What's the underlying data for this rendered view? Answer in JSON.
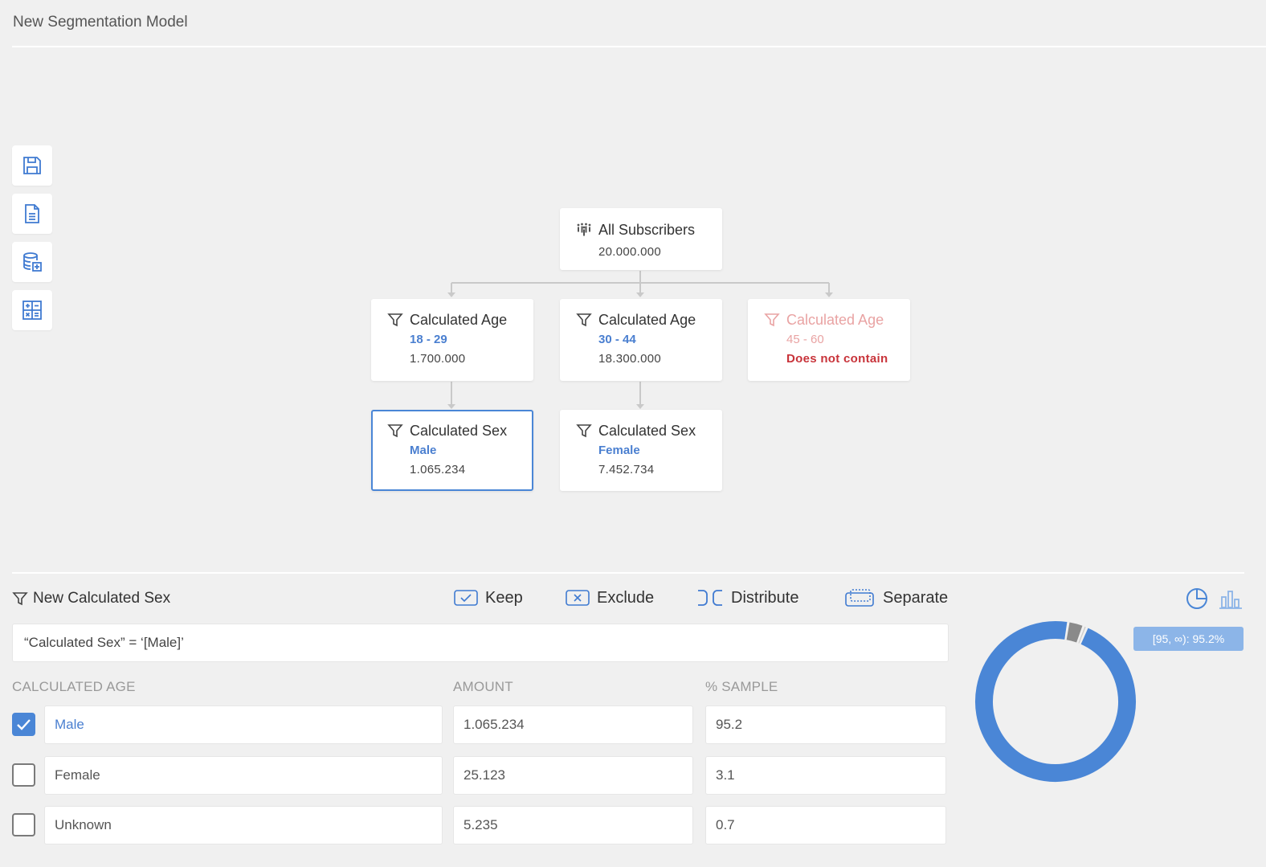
{
  "app": {
    "title": "New Segmentation Model"
  },
  "toolbar": {
    "icons": [
      "save-icon",
      "document-icon",
      "add-database-icon",
      "calculator-icon"
    ]
  },
  "tree": {
    "root": {
      "label": "All Subscribers",
      "count": "20.000.000",
      "icon": "subscribers-icon"
    },
    "level1": [
      {
        "label": "Calculated Age",
        "value": "18 - 29",
        "count": "1.700.000"
      },
      {
        "label": "Calculated Age",
        "value": "30 - 44",
        "count": "18.300.000"
      },
      {
        "label": "Calculated Age",
        "value": "45 - 60",
        "status": "Does not contain"
      }
    ],
    "level2": [
      {
        "label": "Calculated Sex",
        "value": "Male",
        "count": "1.065.234"
      },
      {
        "label": "Calculated Sex",
        "value": "Female",
        "count": "7.452.734"
      }
    ]
  },
  "panel": {
    "title": "New Calculated Sex",
    "actions": {
      "keep": "Keep",
      "exclude": "Exclude",
      "distribute": "Distribute",
      "separate": "Separate"
    },
    "expression": "“Calculated Sex” = ‘[Male]’",
    "columns": {
      "category": "CALCULATED AGE",
      "amount": "AMOUNT",
      "sample": "% SAMPLE"
    },
    "rows": [
      {
        "label": "Male",
        "amount": "1.065.234",
        "sample": "95.2",
        "checked": true
      },
      {
        "label": "Female",
        "amount": "25.123",
        "sample": "3.1",
        "checked": false
      },
      {
        "label": "Unknown",
        "amount": "5.235",
        "sample": "0.7",
        "checked": false
      }
    ]
  },
  "chart": {
    "legend": "[95, ∞): 95.2%",
    "colors": {
      "primary": "#4a86d6",
      "secondary": "#8a8a8a",
      "faint": "#c9c9c9"
    }
  },
  "chart_data": {
    "type": "pie",
    "categories": [
      "Male",
      "Female",
      "Unknown"
    ],
    "values": [
      95.2,
      3.1,
      0.7
    ]
  }
}
